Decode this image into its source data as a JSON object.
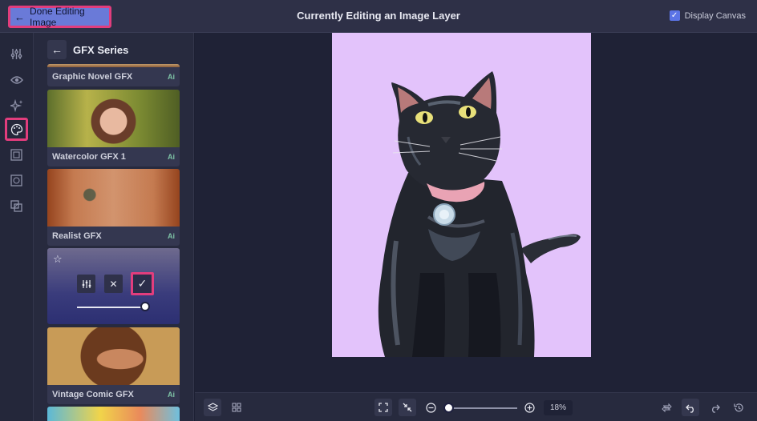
{
  "header": {
    "done_label": "Done Editing Image",
    "title": "Currently Editing an Image Layer",
    "display_canvas_label": "Display Canvas",
    "display_canvas_checked": true
  },
  "rail": {
    "items": [
      "sliders-icon",
      "eye-icon",
      "sparkle-icon",
      "palette-icon",
      "frame-icon",
      "mask-icon",
      "overlay-icon"
    ],
    "active_index": 3
  },
  "panel": {
    "title": "GFX Series",
    "styles": [
      {
        "label": "Graphic Novel GFX",
        "badge": "Ai"
      },
      {
        "label": "Watercolor GFX 1",
        "badge": "Ai"
      },
      {
        "label": "Realist GFX",
        "badge": "Ai"
      },
      {
        "label": "Vintage Comic GFX",
        "badge": "Ai"
      }
    ],
    "editor": {
      "intensity": 1.0
    }
  },
  "toolbar": {
    "zoom_value": "18%",
    "zoom_fraction": 0.0
  },
  "colors": {
    "accent_highlight": "#e23d7d",
    "done_button": "#6a7ad8",
    "canvas_background": "#e3c3fb",
    "checkbox": "#5b74e6"
  }
}
